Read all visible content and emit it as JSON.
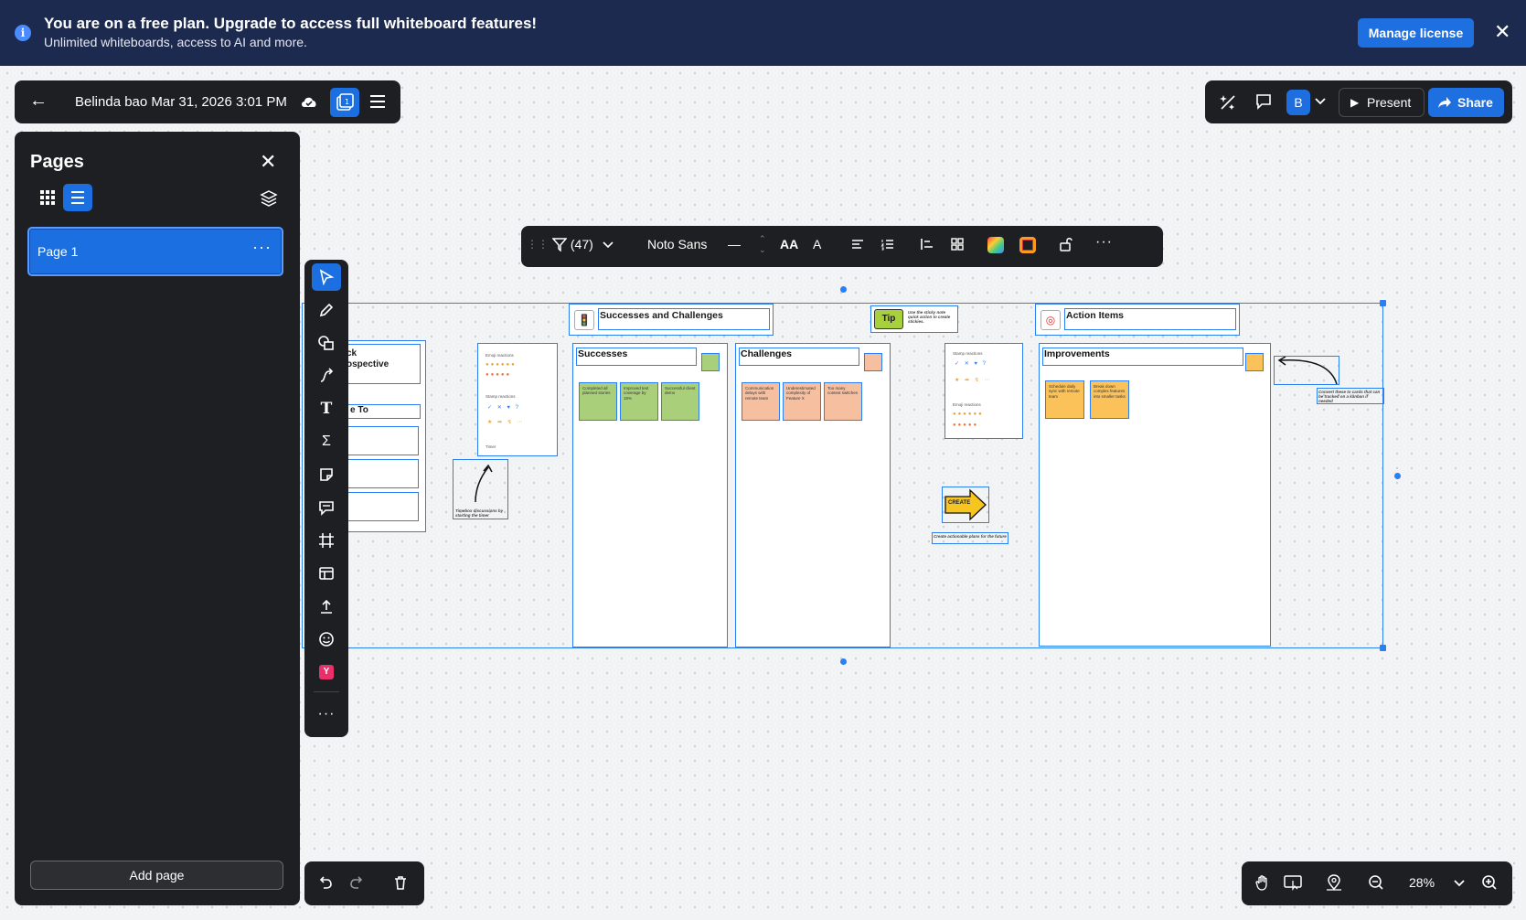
{
  "banner": {
    "title": "You are on a free plan. Upgrade to access full whiteboard features!",
    "subtitle": "Unlimited whiteboards, access to AI and more.",
    "manage_label": "Manage license",
    "info_icon": "i"
  },
  "doc": {
    "name": "Belinda bao Mar 31, 2026 3:01 PM"
  },
  "topright": {
    "avatar": "B",
    "present_label": "Present",
    "share_label": "Share"
  },
  "pages": {
    "title": "Pages",
    "items": [
      {
        "label": "Page 1"
      }
    ],
    "add_label": "Add page"
  },
  "format": {
    "filter_count": "(47)",
    "font": "Noto Sans"
  },
  "zoom": {
    "value": "28%"
  },
  "board": {
    "retro_title_a": "ck",
    "retro_title_b": "ospective",
    "retro_to": "e To",
    "sc_title": "Successes and Challenges",
    "successes": "Successes",
    "challenges": "Challenges",
    "tip": "Tip",
    "tip_text": "Use the sticky note quick action to create stickies.",
    "action_items": "Action Items",
    "improvements": "Improvements",
    "create": "CREATE",
    "create_caption": "Create actionable plans for the future",
    "timer_caption": "Timebox discussions by starting the timer",
    "convert_caption": "Convert these to cards that can be tracked on a kanban if needed",
    "timer_label": "Timer",
    "stamp_reactions": "Stamp reactions",
    "emoji_reactions": "Emoji reactions",
    "success_notes": [
      "Completed all planned stories",
      "Improved test coverage by 15%",
      "Successful client demo"
    ],
    "challenge_notes": [
      "Communication delays with remote team",
      "Underestimated complexity of Feature X",
      "Too many context switches"
    ],
    "improvement_notes": [
      "Schedule daily sync with remote team",
      "Break down complex features into smaller tasks"
    ]
  },
  "colors": {
    "accent": "#1e6fe0",
    "banner_bg": "#1d2a4f",
    "toolbar_bg": "#1e1f22",
    "selection": "#2a7ff5"
  }
}
